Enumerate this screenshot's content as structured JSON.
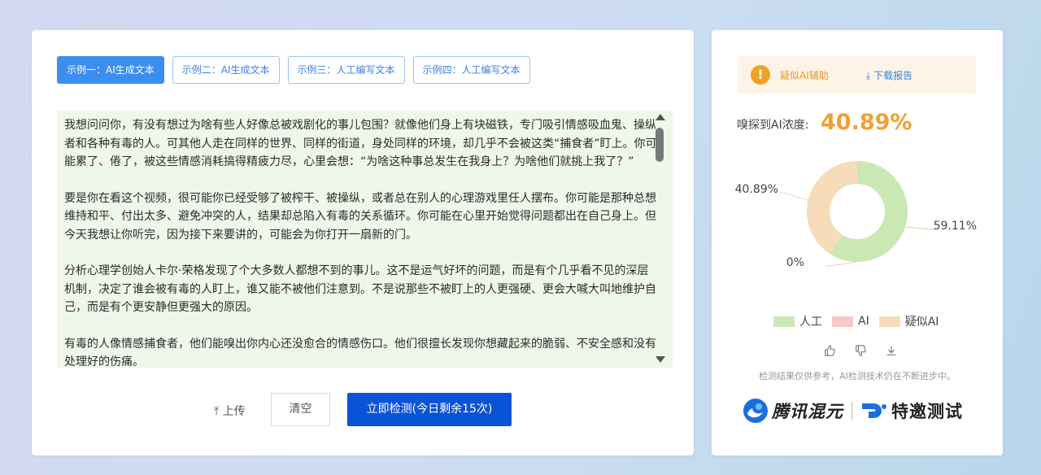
{
  "tabs": [
    {
      "label": "示例一：AI生成文本",
      "active": true
    },
    {
      "label": "示例二：AI生成文本",
      "active": false
    },
    {
      "label": "示例三：人工编写文本",
      "active": false
    },
    {
      "label": "示例四：人工编写文本",
      "active": false
    }
  ],
  "text": {
    "paragraphs": [
      "我想问问你，有没有想过为啥有些人好像总被戏剧化的事儿包围？就像他们身上有块磁铁，专门吸引情感吸血鬼、操纵者和各种有毒的人。可其他人走在同样的世界、同样的街道，身处同样的环境，却几乎不会被这类“捕食者”盯上。你可能累了、倦了，被这些情感消耗搞得精疲力尽，心里会想：“为啥这种事总发生在我身上？为啥他们就挑上我了？”",
      "要是你在看这个视频，很可能你已经受够了被榨干、被操纵，或者总在别人的心理游戏里任人摆布。你可能是那种总想维持和平、付出太多、避免冲突的人，结果却总陷入有毒的关系循环。你可能在心里开始觉得问题都出在自己身上。但今天我想让你听完，因为接下来要讲的，可能会为你打开一扇新的门。",
      "分析心理学创始人卡尔·荣格发现了个大多数人都想不到的事儿。这不是运气好坏的问题，而是有个几乎看不见的深层机制，决定了谁会被有毒的人盯上，谁又能不被他们注意到。不是说那些不被盯上的人更强硬、更会大喊大叫地维护自己，而是有个更安静但更强大的原因。",
      "有毒的人像情感捕食者，他们能嗅出你内心还没愈合的情感伤口。他们很擅长发现你想藏起来的脆弱、不安全感和没有处理好的伤痛。"
    ]
  },
  "actions": {
    "upload_label": "上传",
    "clear_label": "清空",
    "detect_label": "立即检测(今日剩余15次)"
  },
  "result": {
    "alert_label": "疑似AI辅助",
    "download_label": "下载报告",
    "concentration_label": "嗅探到AI浓度:",
    "concentration_value": "40.89%",
    "disclaimer": "检测结果仅供参考，AI检测技术仍在不断进步中。"
  },
  "chart_data": {
    "type": "pie",
    "donut": true,
    "slices": [
      {
        "name": "人工",
        "value": 59.11,
        "label": "59.11%",
        "color": "#c9e8b3"
      },
      {
        "name": "AI",
        "value": 0,
        "label": "0%",
        "color": "#f8c8c8"
      },
      {
        "name": "疑似AI",
        "value": 40.89,
        "label": "40.89%",
        "color": "#f7dcb9"
      }
    ],
    "legend_position": "bottom"
  },
  "brand": {
    "name1": "腾讯混元",
    "name2": "特邀测试"
  },
  "colors": {
    "primary": "#0a53d6",
    "accent_orange": "#f0a030",
    "tab_active": "#3b8eed"
  }
}
